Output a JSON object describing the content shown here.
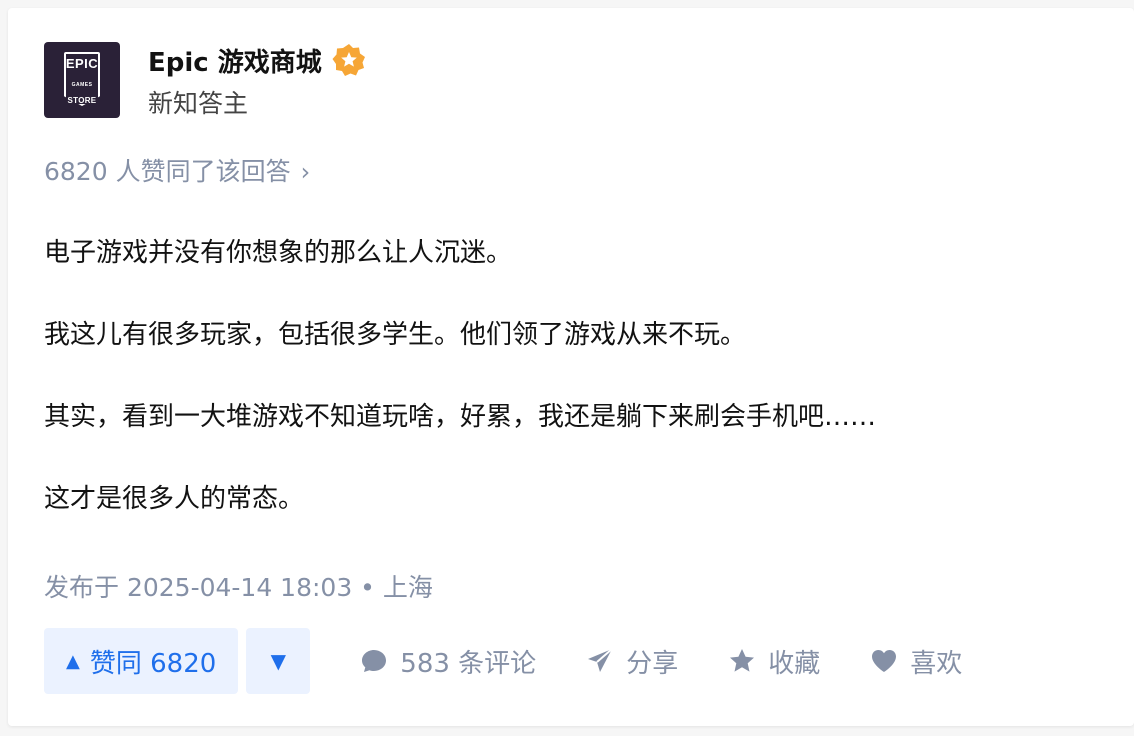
{
  "author": {
    "name": "Epic 游戏商城",
    "title": "新知答主",
    "logo": {
      "line1": "EPIC",
      "line2": "GAMES",
      "line3": "STORE"
    }
  },
  "vote_summary": "6820 人赞同了该回答",
  "content": {
    "paragraphs": [
      "电子游戏并没有你想象的那么让人沉迷。",
      "我这儿有很多玩家，包括很多学生。他们领了游戏从来不玩。",
      "其实，看到一大堆游戏不知道玩啥，好累，我还是躺下来刷会手机吧……",
      "这才是很多人的常态。"
    ]
  },
  "published": "发布于 2025-04-14 18:03 • 上海",
  "actions": {
    "upvote_label": "赞同 6820",
    "comments_label": "583 条评论",
    "share_label": "分享",
    "collect_label": "收藏",
    "like_label": "喜欢"
  },
  "colors": {
    "accent": "#1f6feb",
    "accent_bg": "#ebf2ff",
    "muted": "#8590a6",
    "badge": "#f6a636"
  }
}
